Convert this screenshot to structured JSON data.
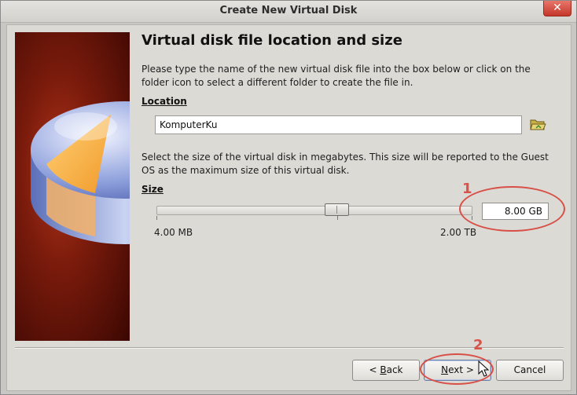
{
  "window": {
    "title": "Create New Virtual Disk",
    "close_glyph": "✕"
  },
  "page": {
    "title": "Virtual disk file location and size",
    "location_description": "Please type the name of the new virtual disk file into the box below or click on the folder icon to select a different folder to create the file in.",
    "location_label_mnemonic": "L",
    "location_label_rest": "ocation",
    "location_value": "KomputerKu",
    "size_description": "Select the size of the virtual disk in megabytes. This size will be reported to the Guest OS as the maximum size of this virtual disk.",
    "size_label_mnemonic": "S",
    "size_label_rest": "ize",
    "slider_min_label": "4.00 MB",
    "slider_max_label": "2.00 TB",
    "size_value": "8.00 GB",
    "slider_position_fraction": 0.57
  },
  "annotations": {
    "marker_1": "1",
    "marker_2": "2",
    "color": "#d84f47"
  },
  "buttons": {
    "back_prefix": "< ",
    "back_mnemonic": "B",
    "back_rest": "ack",
    "next_mnemonic": "N",
    "next_rest": "ext >",
    "cancel": "Cancel"
  },
  "icons": {
    "folder": "folder-open-icon",
    "close": "close-icon",
    "cursor": "mouse-pointer-icon",
    "side_image": "disk-pie-illustration"
  }
}
